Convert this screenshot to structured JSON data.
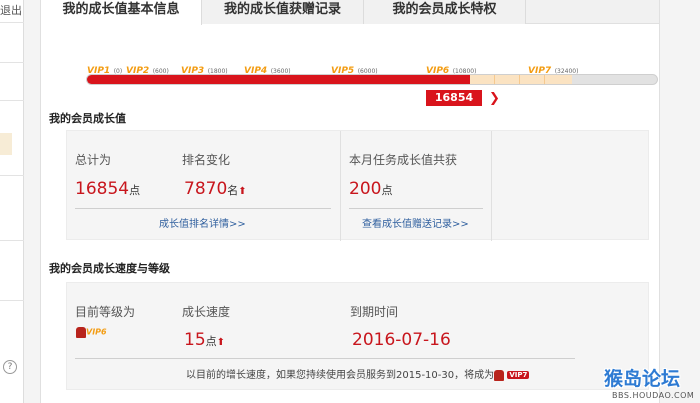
{
  "left_sidebar": {
    "logout_label": "退出",
    "help_label": "?"
  },
  "tabs": [
    {
      "label": "我的成长值基本信息",
      "active": true
    },
    {
      "label": "我的成长值获赠记录",
      "active": false
    },
    {
      "label": "我的会员成长特权",
      "active": false
    }
  ],
  "levels": [
    {
      "name": "VIP1",
      "value": "(0)"
    },
    {
      "name": "VIP2",
      "value": "(600)"
    },
    {
      "name": "VIP3",
      "value": "(1800)"
    },
    {
      "name": "VIP4",
      "value": "(3600)"
    },
    {
      "name": "VIP5",
      "value": "(6000)"
    },
    {
      "name": "VIP6",
      "value": "(10800)"
    },
    {
      "name": "VIP7",
      "value": "(32400)"
    }
  ],
  "progress": {
    "current_value": "16854",
    "next_label": "❯"
  },
  "growth_section": {
    "title": "我的会员成长值",
    "total_label": "总计为",
    "total_value": "16854",
    "total_unit": "点",
    "rank_label": "排名变化",
    "rank_value": "7870",
    "rank_unit": "名",
    "rank_trend": "⬆",
    "monthly_label": "本月任务成长值共获",
    "monthly_value": "200",
    "monthly_unit": "点",
    "rank_link": "成长值排名详情>>",
    "gift_link": "查看成长值赠送记录>>"
  },
  "speed_section": {
    "title": "我的会员成长速度与等级",
    "level_label": "目前等级为",
    "level_badge": "VIP6",
    "speed_label": "成长速度",
    "speed_value": "15",
    "speed_unit": "点",
    "speed_trend": "⬆",
    "expire_label": "到期时间",
    "expire_value": "2016-07-16",
    "footnote": "以目前的增长速度，如果您持续使用会员服务到2015-10-30，将成为",
    "footnote_badge": "VIP7"
  },
  "watermark": {
    "main": "猴岛论坛",
    "sub": "BBS.HOUDAO.COM"
  },
  "colors": {
    "accent_red": "#d9141c",
    "vip_orange": "#f39c12",
    "link_blue": "#2f5f9e"
  }
}
